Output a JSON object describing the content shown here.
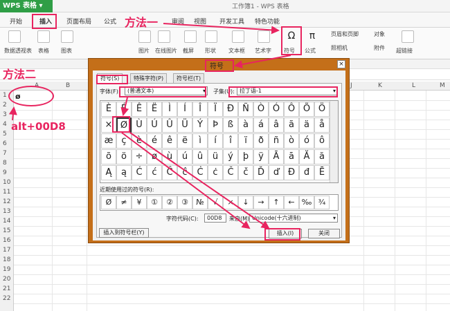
{
  "app": {
    "name": "WPS 表格",
    "doc_title": "工作簿1 - WPS 表格"
  },
  "menu": [
    "开始",
    "插入",
    "页面布局",
    "公式",
    "审阅",
    "视图",
    "开发工具",
    "特色功能"
  ],
  "ribbon": [
    "数据透视表",
    "表格",
    "图表",
    "图片",
    "在线图片",
    "截屏",
    "形状",
    "文本框",
    "艺术字",
    "符号",
    "公式",
    "页眉和页脚",
    "对象",
    "照相机",
    "附件",
    "超链接"
  ],
  "columns": [
    "A",
    "B",
    "J",
    "K",
    "L",
    "M"
  ],
  "rows": [
    "1",
    "2",
    "3",
    "4",
    "5",
    "6",
    "7",
    "8",
    "9",
    "10",
    "11",
    "12",
    "13",
    "14",
    "15",
    "16",
    "17",
    "18",
    "19",
    "20",
    "21",
    "22"
  ],
  "cell_a1": "ø",
  "dialog": {
    "title": "符号",
    "tabs": [
      "符号(S)",
      "特殊字符(P)",
      "符号栏(T)"
    ],
    "font_label": "字体(F):",
    "font_value": "(普通文本)",
    "subset_label": "子集(U):",
    "subset_value": "拉丁语-1",
    "symbols": [
      "È",
      "É",
      "Ê",
      "Ë",
      "Ì",
      "Í",
      "Î",
      "Ï",
      "Ð",
      "Ñ",
      "Ò",
      "Ó",
      "Ô",
      "Õ",
      "Ö",
      "×",
      "Ø",
      "Ù",
      "Ú",
      "Û",
      "Ü",
      "Ý",
      "Þ",
      "ß",
      "à",
      "á",
      "â",
      "ã",
      "ä",
      "å",
      "æ",
      "ç",
      "è",
      "é",
      "ê",
      "ë",
      "ì",
      "í",
      "î",
      "ï",
      "ð",
      "ñ",
      "ò",
      "ó",
      "ô",
      "õ",
      "ö",
      "÷",
      "ø",
      "ù",
      "ú",
      "û",
      "ü",
      "ý",
      "þ",
      "ÿ",
      "Ā",
      "ā",
      "Ă",
      "ă",
      "Ą",
      "ą",
      "Ć",
      "ć",
      "Ĉ",
      "ĉ",
      "Ċ",
      "ċ",
      "Č",
      "č",
      "Ď",
      "ď",
      "Đ",
      "đ",
      "Ē"
    ],
    "recent_label": "近期使用过的符号(R):",
    "recent": [
      "Ø",
      "≠",
      "¥",
      "①",
      "②",
      "③",
      "№",
      "√",
      "×",
      "↓",
      "→",
      "↑",
      "←",
      "‰",
      "¾"
    ],
    "charcode_label": "字符代码(C):",
    "charcode_value": "00D8",
    "from_label": "来自(M)",
    "from_value": "Unicode(十六进制)",
    "insert_to_bar": "插入到符号栏(Y)",
    "insert": "插入(I)",
    "close": "关闭"
  },
  "annotations": {
    "method1": "方法一",
    "method2": "方法二",
    "alt_code": "alt+00D8"
  }
}
